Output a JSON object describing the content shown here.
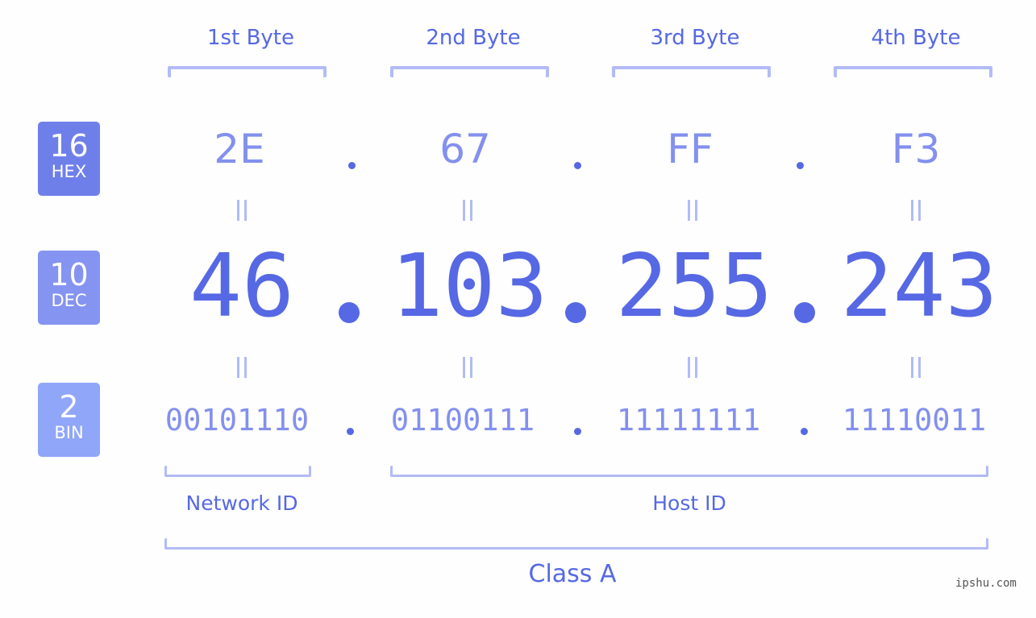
{
  "bytes": {
    "headers": [
      "1st Byte",
      "2nd Byte",
      "3rd Byte",
      "4th Byte"
    ]
  },
  "badges": {
    "hex": {
      "base": "16",
      "label": "HEX",
      "color": "#6f7fea"
    },
    "dec": {
      "base": "10",
      "label": "DEC",
      "color": "#8593f1"
    },
    "bin": {
      "base": "2",
      "label": "BIN",
      "color": "#90a6f8"
    }
  },
  "address": {
    "hex": [
      "2E",
      "67",
      "FF",
      "F3"
    ],
    "dec": [
      "46",
      "103",
      "255",
      "243"
    ],
    "bin": [
      "00101110",
      "01100111",
      "11111111",
      "11110011"
    ]
  },
  "segments": {
    "network_id": "Network ID",
    "host_id": "Host ID",
    "class": "Class A"
  },
  "colors": {
    "primary": "#5668e4",
    "secondary": "#8390ee",
    "bracket": "#b3bbf6"
  },
  "watermark": "ipshu.com"
}
